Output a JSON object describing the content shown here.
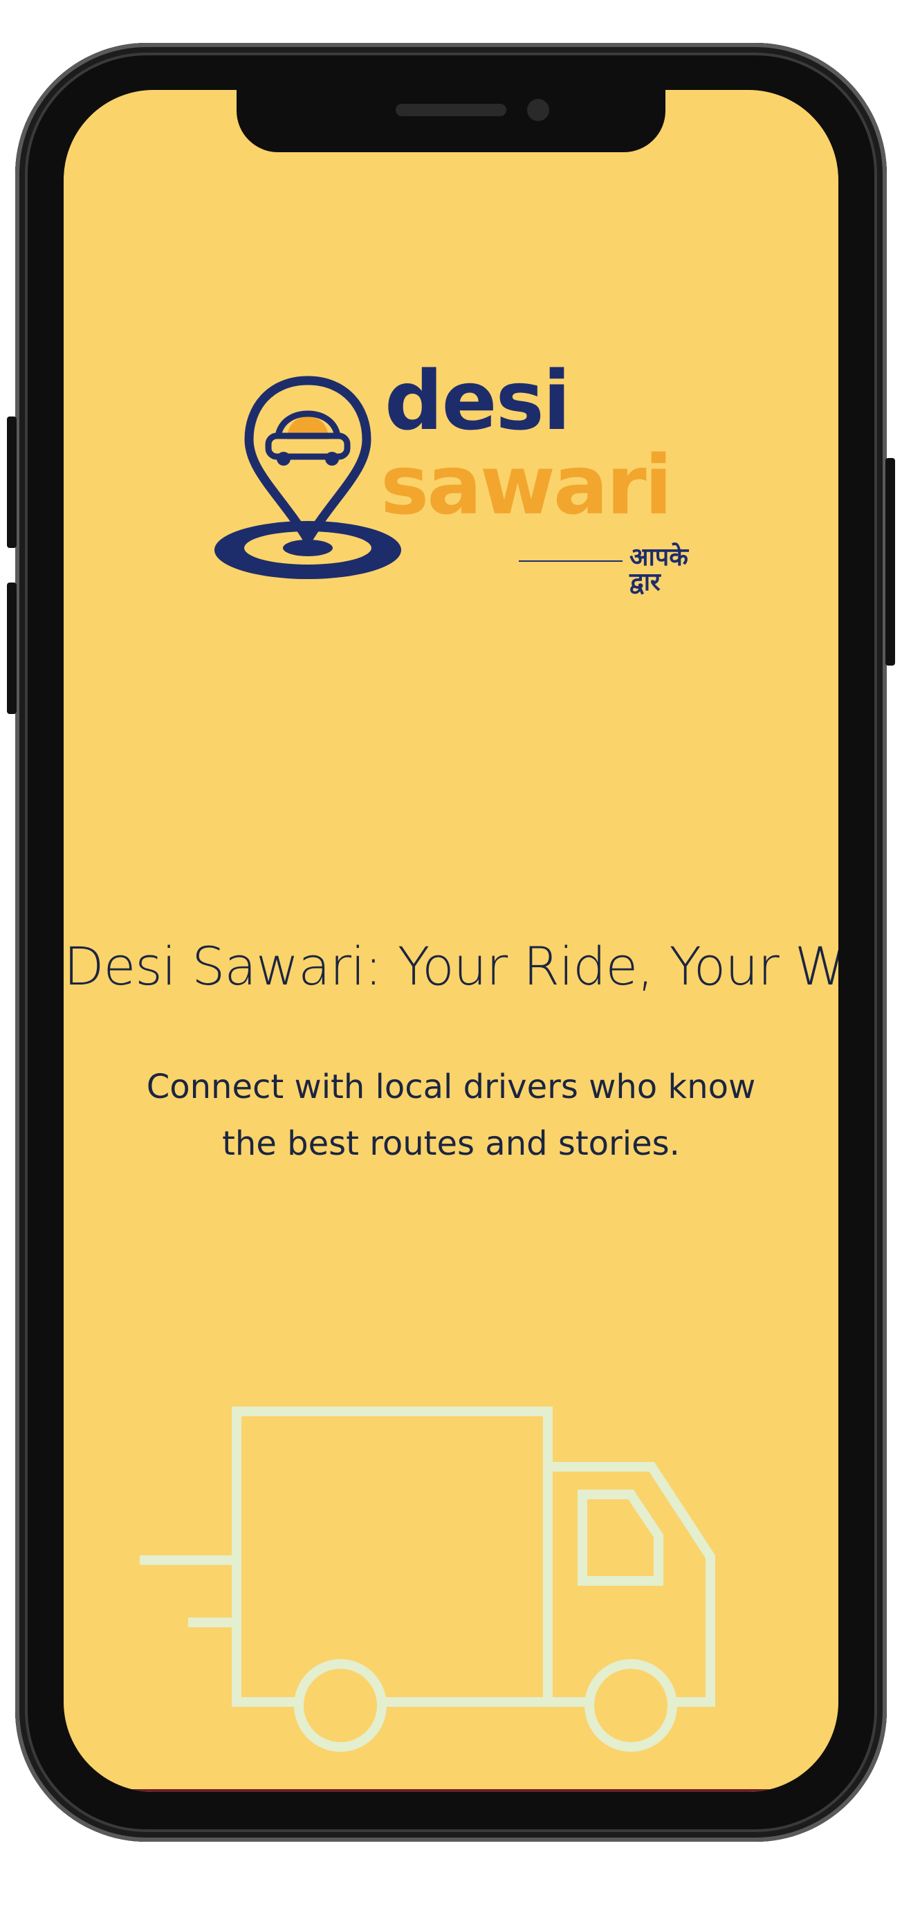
{
  "logo": {
    "word1": "desi",
    "word2": "sawari",
    "tagline": "आपके द्वार",
    "colors": {
      "navy": "#1d2d6b",
      "orange": "#f2a62e"
    }
  },
  "hero": {
    "headline": "Desi Sawari: Your Ride, Your Way",
    "subtitle_line1": "Connect with local drivers who know",
    "subtitle_line2": "the best routes and stories."
  },
  "icons": {
    "truck": "truck-icon",
    "pin": "map-pin-icon"
  },
  "colors": {
    "screen_bg": "#fbd36b",
    "text": "#1a2540",
    "truck_stroke": "#e3efcf"
  }
}
